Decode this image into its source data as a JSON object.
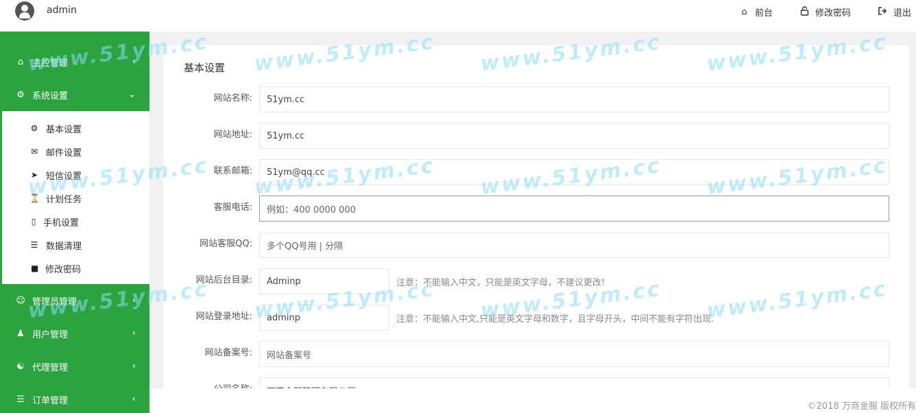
{
  "header": {
    "username": "admin",
    "links": [
      {
        "label": "前台",
        "icon": "home-icon"
      },
      {
        "label": "修改密码",
        "icon": "unlock-icon"
      },
      {
        "label": "退出",
        "icon": "sign-out-icon"
      }
    ]
  },
  "sidebar": {
    "items": [
      {
        "label": "主控管理",
        "icon": "home-icon"
      },
      {
        "label": "系统设置",
        "icon": "gears-icon"
      },
      {
        "label": "管理员管理",
        "icon": "user-circle-icon"
      },
      {
        "label": "用户管理",
        "icon": "users-icon"
      },
      {
        "label": "代理管理",
        "icon": "handshake-icon"
      },
      {
        "label": "订单管理",
        "icon": "list-icon"
      }
    ],
    "submenu": [
      {
        "label": "基本设置",
        "icon": "cog-icon"
      },
      {
        "label": "邮件设置",
        "icon": "envelope-icon"
      },
      {
        "label": "短信设置",
        "icon": "paper-plane-icon"
      },
      {
        "label": "计划任务",
        "icon": "hourglass-icon"
      },
      {
        "label": "手机设置",
        "icon": "mobile-icon"
      },
      {
        "label": "数据清理",
        "icon": "database-icon"
      },
      {
        "label": "修改密码",
        "icon": "lock-icon"
      }
    ]
  },
  "form": {
    "title": "基本设置",
    "fields": [
      {
        "label": "网站名称:",
        "value": "51ym.cc",
        "placeholder": ""
      },
      {
        "label": "网站地址:",
        "value": "51ym.cc",
        "placeholder": ""
      },
      {
        "label": "联系邮箱:",
        "value": "51ym@qq.cc",
        "placeholder": ""
      },
      {
        "label": "客服电话:",
        "value": "",
        "placeholder": "例如：400 0000 000"
      },
      {
        "label": "网站客服QQ:",
        "value": "",
        "placeholder": "多个QQ号用 | 分隔"
      },
      {
        "label": "网站后台目录:",
        "value": "Adminp",
        "note": "注意：不能输入中文，只能是英文字母，不建议更改!"
      },
      {
        "label": "网站登录地址:",
        "value": "adminp",
        "note": "注意：不能输入中文,只能是英文字母和数字，且字母开头，中间不能有字符出现."
      },
      {
        "label": "网站备案号:",
        "value": "",
        "placeholder": "网站备案号"
      },
      {
        "label": "公司名称:",
        "value": "万商金服管理有限公司",
        "placeholder": ""
      }
    ]
  },
  "footer": {
    "copyright": "©2018 万商金服 版权所有"
  },
  "watermark": "www.51ym.cc"
}
